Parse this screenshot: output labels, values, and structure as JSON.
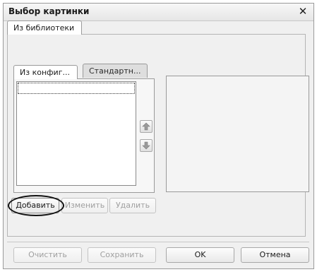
{
  "window": {
    "title": "Выбор картинки",
    "close_glyph": "✕"
  },
  "top_tabs": [
    {
      "label": "Из библиотеки",
      "active": true
    }
  ],
  "inner_tabs": [
    {
      "label": "Из конфиг...",
      "active": true
    },
    {
      "label": "Стандартн...",
      "active": false
    }
  ],
  "list": {
    "items": [
      ""
    ]
  },
  "icons": {
    "move_up": "arrow-up-icon",
    "move_down": "arrow-down-icon"
  },
  "list_buttons": {
    "add": "Добавить",
    "edit": "Изменить",
    "delete": "Удалить"
  },
  "footer_buttons": {
    "clear": "Очистить",
    "save": "Сохранить",
    "ok": "OK",
    "cancel": "Отмена"
  },
  "colors": {
    "dialog_bg": "#f0f0f0",
    "border": "#9a9a9a",
    "disabled_text": "#a0a0a0",
    "highlight": "#111111"
  }
}
